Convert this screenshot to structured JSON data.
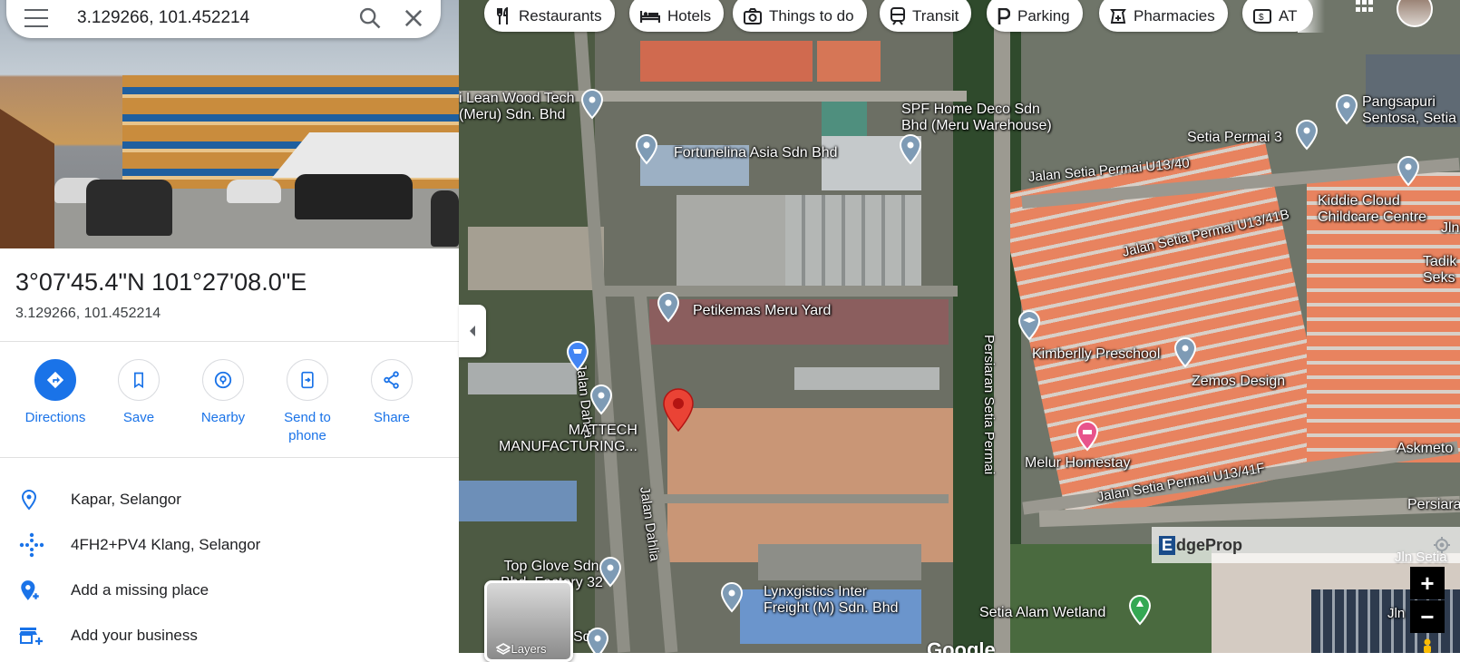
{
  "search": {
    "value": "3.129266, 101.452214"
  },
  "place": {
    "dms": "3°07'45.4\"N 101°27'08.0\"E",
    "decimal": "3.129266, 101.452214"
  },
  "actions": [
    {
      "label": "Directions"
    },
    {
      "label": "Save"
    },
    {
      "label": "Nearby"
    },
    {
      "label": "Send to phone"
    },
    {
      "label": "Share"
    }
  ],
  "info_rows": [
    {
      "text": "Kapar, Selangor",
      "icon": "location-pin-icon"
    },
    {
      "text": "4FH2+PV4 Klang, Selangor",
      "icon": "plus-code-icon"
    },
    {
      "text": "Add a missing place",
      "icon": "add-location-icon"
    },
    {
      "text": "Add your business",
      "icon": "add-business-icon"
    }
  ],
  "chips": [
    {
      "label": "Restaurants",
      "icon": "fork-knife-icon"
    },
    {
      "label": "Hotels",
      "icon": "bed-icon"
    },
    {
      "label": "Things to do",
      "icon": "camera-icon"
    },
    {
      "label": "Transit",
      "icon": "train-icon"
    },
    {
      "label": "Parking",
      "icon": "parking-icon"
    },
    {
      "label": "Pharmacies",
      "icon": "pharmacy-icon"
    },
    {
      "label": "AT",
      "icon": "atm-icon"
    }
  ],
  "map_labels": {
    "lean_wood": "i Lean Wood Tech\n(Meru) Sdn. Bhd",
    "fortunelina": "Fortunelina Asia Sdn Bhd",
    "spf": "SPF Home Deco Sdn\nBhd (Meru Warehouse)",
    "pangsapuri": "Pangsapuri\nSentosa, Setia",
    "setia_permai3": "Setia Permai 3",
    "jalan_u13_40": "Jalan Setia Permai U13/40",
    "kiddie": "Kiddie Cloud\nChildcare Centre",
    "jln_edge": "Jln",
    "jalan_u13_41b": "Jalan Setia Permai U13/41B",
    "tadik": "Tadik\nSeks",
    "petikemas": "Petikemas Meru Yard",
    "jalan_dahlia_1": "Jalan Dahlia",
    "persiaran_setia_permai": "Persiaran Setia Permai",
    "kimberlly": "Kimberlly Preschool",
    "zemos": "Zemos Design",
    "mattech": "MATTECH\nMANUFACTURING...",
    "melur": "Melur Homestay",
    "askmeto": "Askmeto",
    "jalan_u13_41f": "Jalan Setia Permai U13/41F",
    "persiara": "Persiara",
    "jalan_dahlia_2": "Jalan Dahlia",
    "top_glove": "Top Glove Sdn.\nBhd. Factory 32",
    "lynxgistics": "Lynxgistics Inter\nFreight (M) Sdn. Bhd",
    "setia_alam": "Setia Alam Wetland",
    "jln_seti": "Jln Setia",
    "jln_bottom": "Jln",
    "sdn_bottom": "Sdn.",
    "layers": "Layers",
    "google": "Google"
  },
  "edgeprop": {
    "brand_letter": "E",
    "brand_rest": "dgeProp"
  },
  "zoom": {
    "in": "+",
    "out": "−"
  },
  "colors": {
    "accent": "#1a73e8",
    "pin_red": "#ea4335"
  }
}
